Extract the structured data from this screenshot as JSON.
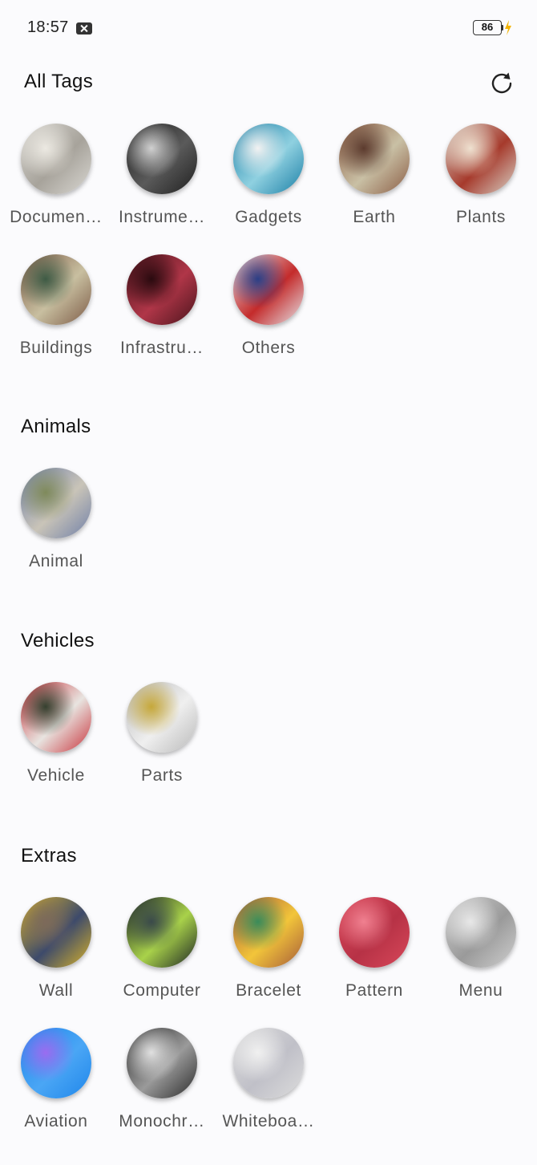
{
  "status_bar": {
    "time": "18:57",
    "battery_level": "86",
    "notification_icon": "close-box-icon",
    "charging_icon": "bolt-icon"
  },
  "all_tags": {
    "title": "All Tags",
    "refresh_icon": "refresh-icon",
    "items": [
      {
        "label": "Documen…",
        "image": "receipt document",
        "colors": [
          "#d9d7d2",
          "#a7a39b",
          "#ece9e2"
        ]
      },
      {
        "label": "Instrume…",
        "image": "black instrument panel",
        "colors": [
          "#1f1f1f",
          "#5a5a5a",
          "#d0d0d0"
        ]
      },
      {
        "label": "Gadgets",
        "image": "phone screen",
        "colors": [
          "#1b7fa6",
          "#8fd0e0",
          "#f2f2f2"
        ]
      },
      {
        "label": "Earth",
        "image": "shop front",
        "colors": [
          "#8b5d45",
          "#c9c0a5",
          "#5c3b2e"
        ]
      },
      {
        "label": "Plants",
        "image": "flower on wall",
        "colors": [
          "#d8d3c8",
          "#a63a2c",
          "#efe1d0"
        ]
      },
      {
        "label": "Buildings",
        "image": "shop front",
        "colors": [
          "#7c5a46",
          "#c8bfa0",
          "#3e5b45"
        ]
      },
      {
        "label": "Infrastru…",
        "image": "red fabric",
        "colors": [
          "#4a141c",
          "#b03648",
          "#2a0a0f"
        ]
      },
      {
        "label": "Others",
        "image": "papers",
        "colors": [
          "#e6e6ea",
          "#c42b2b",
          "#2b3f86"
        ]
      }
    ]
  },
  "animals": {
    "title": "Animals",
    "items": [
      {
        "label": "Animal",
        "image": "wall poster",
        "colors": [
          "#6f7fa8",
          "#c9c4b8",
          "#7f8a5b"
        ]
      }
    ]
  },
  "vehicles": {
    "title": "Vehicles",
    "items": [
      {
        "label": "Vehicle",
        "image": "banner sign",
        "colors": [
          "#c8323a",
          "#e8e4e0",
          "#35402f"
        ]
      },
      {
        "label": "Parts",
        "image": "glass container",
        "colors": [
          "#b9b9b9",
          "#efefef",
          "#c6a83a"
        ]
      }
    ]
  },
  "extras": {
    "title": "Extras",
    "items": [
      {
        "label": "Wall",
        "image": "yellow wall entrance",
        "colors": [
          "#d9b32a",
          "#3d4a6b",
          "#7d6a5a"
        ]
      },
      {
        "label": "Computer",
        "image": "keyboard",
        "colors": [
          "#1c2424",
          "#a9d24a",
          "#3a4a4a"
        ]
      },
      {
        "label": "Bracelet",
        "image": "rakhi bracelet",
        "colors": [
          "#a55a3a",
          "#f2c53a",
          "#3a8c5a"
        ]
      },
      {
        "label": "Pattern",
        "image": "pink shirt",
        "colors": [
          "#d8485a",
          "#b73246",
          "#f08090"
        ]
      },
      {
        "label": "Menu",
        "image": "printed page",
        "colors": [
          "#cfcfcf",
          "#9a9a9a",
          "#e8e8e8"
        ]
      },
      {
        "label": "Aviation",
        "image": "blue phone screen",
        "colors": [
          "#1f86ea",
          "#4aa6f5",
          "#9a6cf0"
        ]
      },
      {
        "label": "Monochr…",
        "image": "black and white scene",
        "colors": [
          "#2a2a2a",
          "#9a9a9a",
          "#e0e0e0"
        ]
      },
      {
        "label": "Whiteboa…",
        "image": "whiteboard",
        "colors": [
          "#dcdcdc",
          "#c0c0c8",
          "#f0f0f0"
        ]
      }
    ]
  }
}
